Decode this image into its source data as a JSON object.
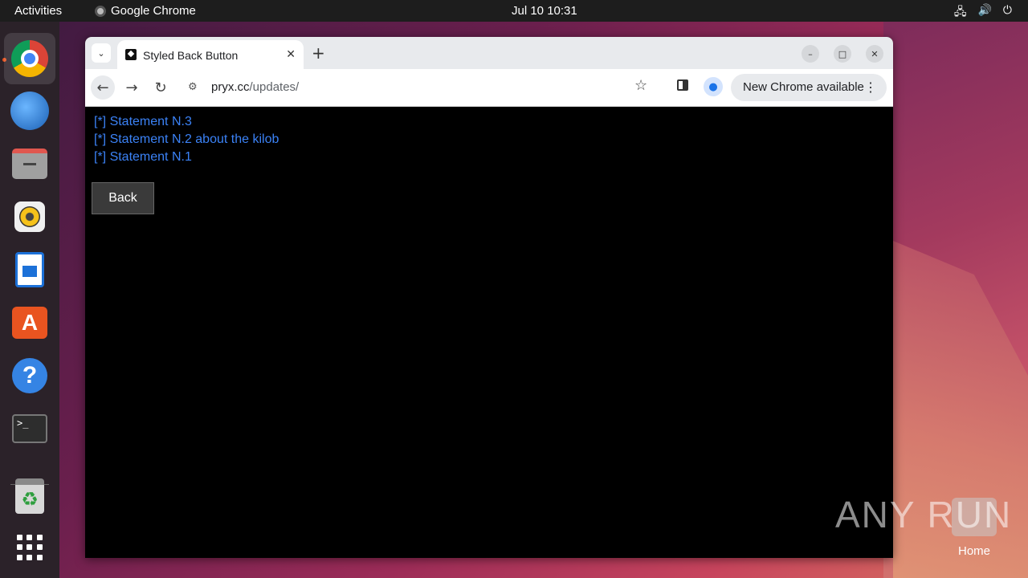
{
  "topbar": {
    "activities": "Activities",
    "app_name": "Google Chrome",
    "clock": "Jul 10  10:31",
    "tray": [
      "network-icon",
      "volume-icon",
      "power-icon"
    ]
  },
  "dock": {
    "items": [
      {
        "name": "chrome",
        "running": true
      },
      {
        "name": "thunderbird"
      },
      {
        "name": "files"
      },
      {
        "name": "rhythmbox"
      },
      {
        "name": "libreoffice-writer"
      },
      {
        "name": "app-center"
      },
      {
        "name": "help"
      },
      {
        "name": "terminal"
      },
      {
        "name": "trash"
      },
      {
        "name": "show-apps"
      }
    ],
    "terminal_glyph": ">_",
    "trash_glyph": "♻"
  },
  "browser": {
    "tab": {
      "title": "Styled Back Button",
      "close": "✕"
    },
    "new_tab": "+",
    "tab_dropdown": "⌄",
    "window_buttons": {
      "minimize": "–",
      "maximize": "□",
      "close": "✕"
    },
    "nav": {
      "back": "←",
      "forward": "→",
      "reload": "↻"
    },
    "url": {
      "host": "pryx.cc",
      "path": "/updates/"
    },
    "site_info_icon": "⚙",
    "star": "☆",
    "update_pill": {
      "label": "New Chrome available",
      "more": "⋮"
    }
  },
  "page": {
    "statements": [
      "[*] Statement N.3",
      "[*] Statement N.2 about the kilob",
      "[*] Statement N.1"
    ],
    "back_button": "Back"
  },
  "desktop": {
    "watermark": "ANY  RUN",
    "home_label": "Home"
  },
  "colors": {
    "link_blue": "#3b82f6",
    "ubuntu_orange": "#e95420"
  }
}
